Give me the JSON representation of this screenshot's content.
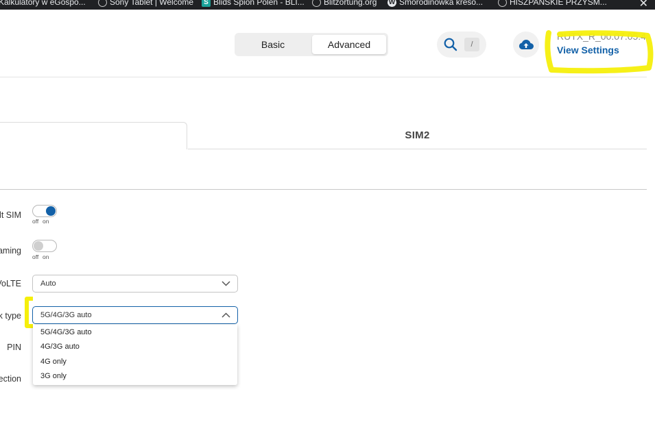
{
  "bookmarks": [
    {
      "label": "Kalkulatory w eGospo...",
      "icon": "none"
    },
    {
      "label": "Sony Tablet | Welcome",
      "icon": "globe-icon"
    },
    {
      "label": "Blids Spion Polen - BLI...",
      "icon": "s-logo-icon"
    },
    {
      "label": "Blitzortung.org",
      "icon": "globe-icon"
    },
    {
      "label": "Smorodinowka kreso...",
      "icon": "wordpress-icon"
    },
    {
      "label": "HISZPAŃSKIE PRZYSM...",
      "icon": "globe-icon"
    }
  ],
  "bookmark_letters": {
    "s_logo": "S",
    "wordpress": "W"
  },
  "window_close": "✕",
  "header": {
    "mode_basic": "Basic",
    "mode_advanced": "Advanced",
    "search_shortcut": "/",
    "firmware": "RUTX_R_00.07.05.4",
    "view_settings": "View Settings"
  },
  "tabs": {
    "sim2": "SIM2"
  },
  "form": {
    "default_sim_label": "lt SIM",
    "roaming_label": "aming",
    "volte_label": "VoLTE",
    "network_type_label": "k type",
    "pin_label": "PIN",
    "connection_label": "ection",
    "toggle_off": "off",
    "toggle_on": "on",
    "volte_value": "Auto",
    "network_type_value": "5G/4G/3G auto",
    "network_type_options": [
      "5G/4G/3G auto",
      "4G/3G auto",
      "4G only",
      "3G only"
    ]
  },
  "colors": {
    "accent": "#1361a8",
    "highlight": "#f5ef0c"
  }
}
